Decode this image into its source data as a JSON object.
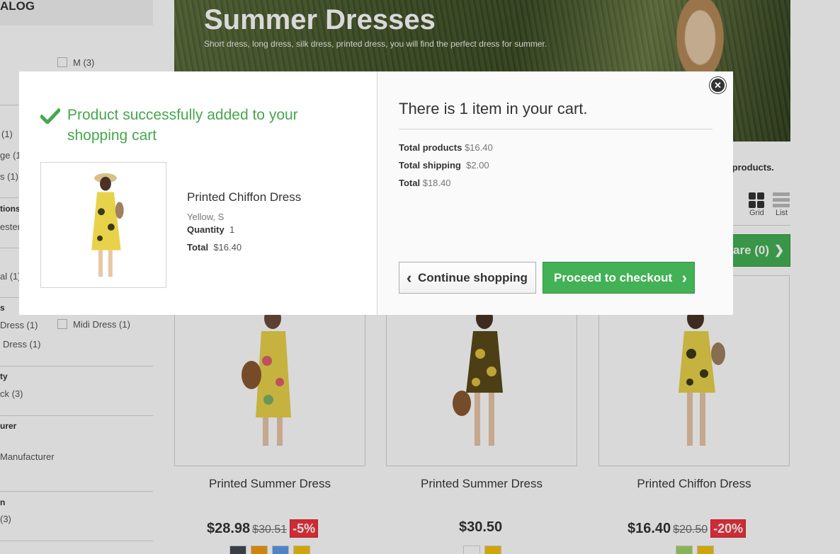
{
  "sidebar": {
    "catalog_title": "ALOG",
    "size_m": "M (3)",
    "color_1": "(1)",
    "color_2": "ge (1)",
    "color_3": "s (1)",
    "compositions_title": "tions",
    "compositions_item": "ester",
    "properties_item": "al (1)",
    "styles_title": "s",
    "style_1": "Dress (1)",
    "style_2": "Dress (1)",
    "style_midi": "Midi Dress (1)",
    "availability_title": "ty",
    "availability_item": "ck (3)",
    "manufacturer_title": "urer",
    "manufacturer_item": "Manufacturer",
    "condition_title": "n",
    "condition_item": "(3)"
  },
  "banner": {
    "title": "Summer Dresses",
    "subtitle": "Short dress, long dress, silk dress, printed dress, you will find the perfect dress for summer."
  },
  "listing": {
    "products_count": "e 3 products.",
    "view_grid": "Grid",
    "view_list": "List",
    "compare_label": "are (0)"
  },
  "products": [
    {
      "name": "Printed Summer Dress",
      "price": "$28.98",
      "old_price": "$30.51",
      "reduction": "-5%",
      "colors": [
        "#434a54",
        "#f39c11",
        "#5d9cec",
        "#f1c40f"
      ]
    },
    {
      "name": "Printed Summer Dress",
      "price": "$30.50",
      "old_price": "",
      "reduction": "",
      "colors": [
        "#ffffff",
        "#f1c40f"
      ]
    },
    {
      "name": "Printed Chiffon Dress",
      "price": "$16.40",
      "old_price": "$20.50",
      "reduction": "-20%",
      "colors": [
        "#a0d468",
        "#f1c40f"
      ]
    }
  ],
  "modal": {
    "success_message": "Product successfully added to your shopping cart",
    "product_name": "Printed Chiffon Dress",
    "attributes": "Yellow, S",
    "quantity_label": "Quantity",
    "quantity_value": "1",
    "total_label": "Total",
    "total_value": "$16.40",
    "cart_title": "There is 1 item in your cart.",
    "total_products_label": "Total products",
    "total_products_value": "$16.40",
    "total_shipping_label": "Total shipping",
    "total_shipping_value": "$2.00",
    "cart_total_label": "Total",
    "cart_total_value": "$18.40",
    "continue_label": "Continue shopping",
    "checkout_label": "Proceed to checkout",
    "close_icon": "close-icon"
  },
  "colors": {
    "success_green": "#46a74e",
    "button_green": "#43b155",
    "sale_red": "#f13340"
  }
}
